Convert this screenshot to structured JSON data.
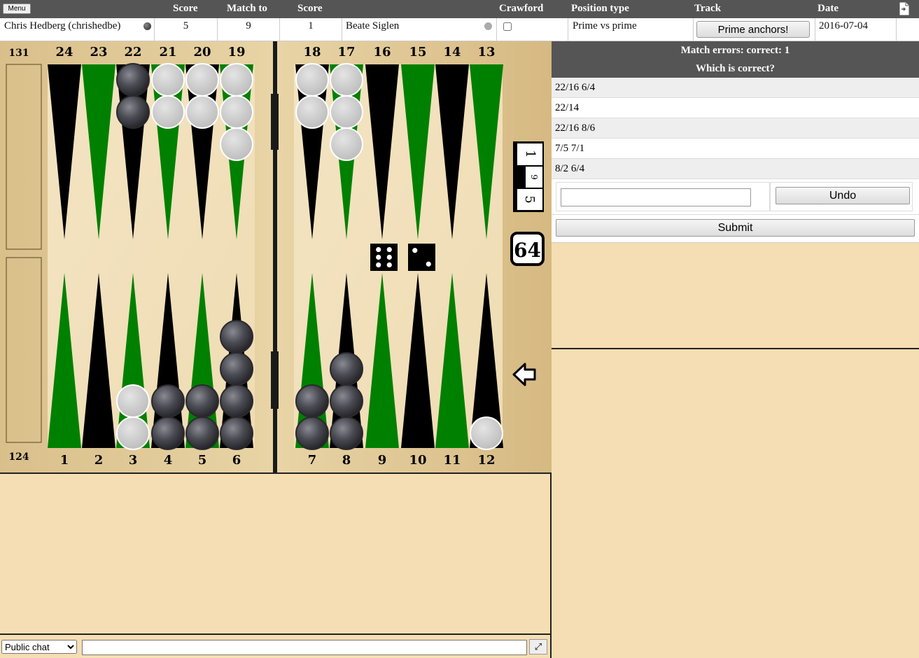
{
  "header": {
    "menu_label": "Menu",
    "col_score1": "Score",
    "col_match_to": "Match to",
    "col_score2": "Score",
    "col_crawford": "Crawford",
    "col_position_type": "Position type",
    "col_track": "Track",
    "col_date": "Date",
    "export_icon": "document-export-icon"
  },
  "match": {
    "player1": "Chris Hedberg (chrishedbe)",
    "score1": "5",
    "match_to": "9",
    "score2": "1",
    "player2": "Beate Siglen",
    "crawford_checked": false,
    "position_type": "Prime vs prime",
    "track": "Prime anchors!",
    "date": "2016-07-04"
  },
  "board": {
    "pip_top": "131",
    "pip_bottom": "124",
    "top_points": [
      "24",
      "23",
      "22",
      "21",
      "20",
      "19",
      "18",
      "17",
      "16",
      "15",
      "14",
      "13"
    ],
    "bottom_points": [
      "1",
      "2",
      "3",
      "4",
      "5",
      "6",
      "7",
      "8",
      "9",
      "10",
      "11",
      "12"
    ],
    "cube_value": "64",
    "score_tracker": [
      "1",
      "9",
      "5"
    ],
    "dice": [
      6,
      2
    ],
    "checkers": [
      {
        "point": 22,
        "color": "dark",
        "count": 2
      },
      {
        "point": 21,
        "color": "light",
        "count": 2
      },
      {
        "point": 20,
        "color": "light",
        "count": 2
      },
      {
        "point": 19,
        "color": "light",
        "count": 3
      },
      {
        "point": 18,
        "color": "light",
        "count": 2
      },
      {
        "point": 17,
        "color": "light",
        "count": 3
      },
      {
        "point": 3,
        "color": "light",
        "count": 2
      },
      {
        "point": 4,
        "color": "dark",
        "count": 2
      },
      {
        "point": 5,
        "color": "dark",
        "count": 2
      },
      {
        "point": 6,
        "color": "dark",
        "count": 4
      },
      {
        "point": 7,
        "color": "dark",
        "count": 2
      },
      {
        "point": 8,
        "color": "dark",
        "count": 3
      },
      {
        "point": 12,
        "color": "light",
        "count": 1
      }
    ],
    "colors": {
      "green": "#008000",
      "black": "#000000",
      "wood": "#e6d3a8"
    }
  },
  "panel": {
    "title": "Match errors: correct: 1",
    "question": "Which is correct?",
    "choices": [
      "22/16 6/4",
      "22/14",
      "22/16 8/6",
      "7/5 7/1",
      "8/2 6/4"
    ],
    "undo_label": "Undo",
    "submit_label": "Submit",
    "answer_value": ""
  },
  "chat": {
    "channel": "Public chat",
    "input_value": ""
  }
}
